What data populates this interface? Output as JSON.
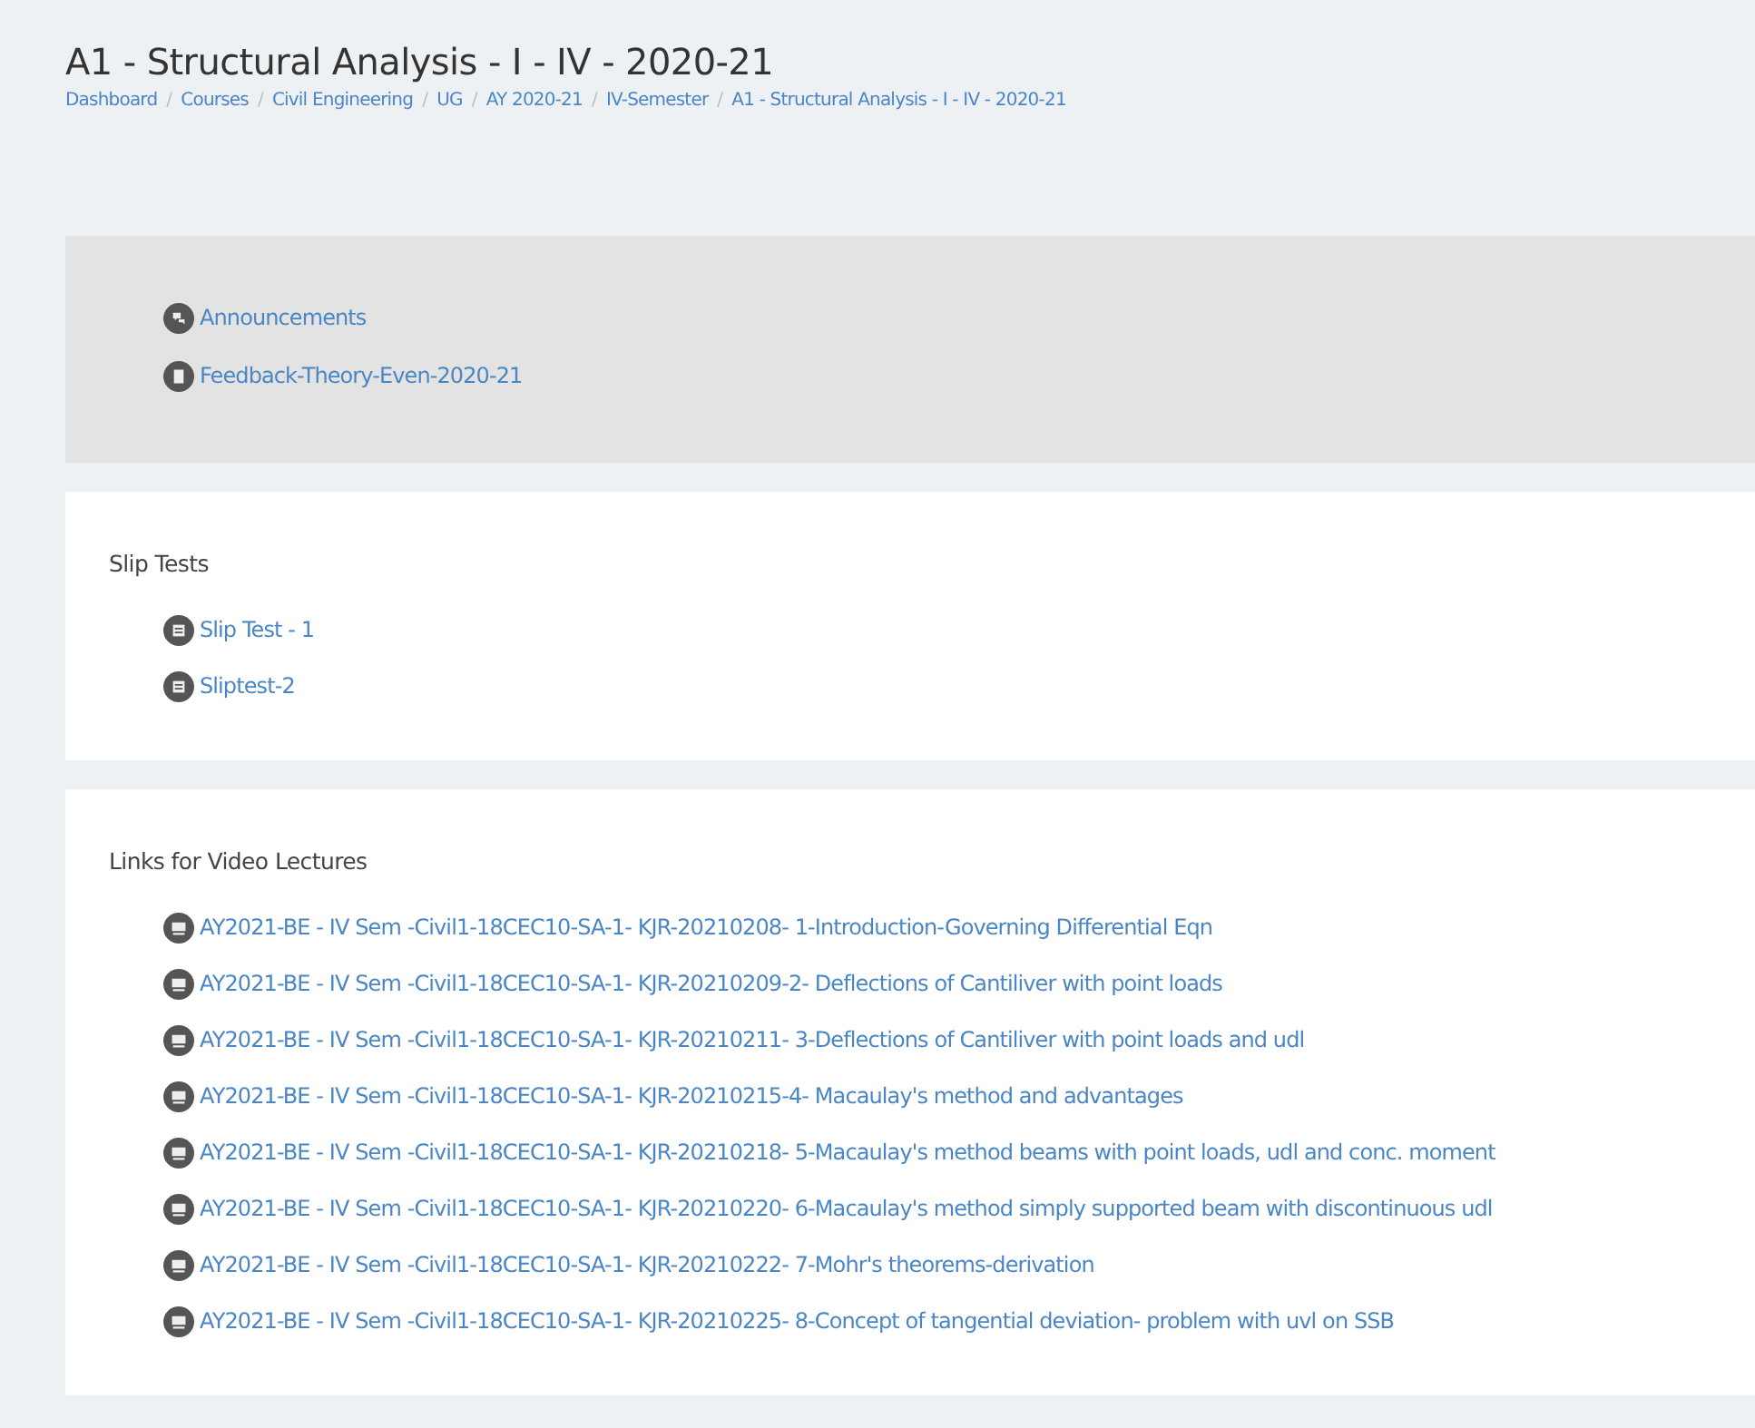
{
  "header": {
    "title": "A1 - Structural Analysis - I - IV - 2020-21",
    "breadcrumb_separator": "/",
    "breadcrumb": [
      "Dashboard",
      "Courses",
      "Civil Engineering",
      "UG",
      "AY 2020-21",
      "IV-Semester",
      "A1 - Structural Analysis - I - IV - 2020-21"
    ]
  },
  "sections": [
    {
      "kind": "highlight",
      "items": [
        {
          "kind": "forum",
          "label": "Announcements"
        },
        {
          "kind": "feedback",
          "label": "Feedback-Theory-Even-2020-21"
        }
      ]
    },
    {
      "kind": "plain",
      "title": "Slip Tests",
      "items": [
        {
          "kind": "quiz",
          "label": "Slip Test - 1"
        },
        {
          "kind": "quiz",
          "label": "Sliptest-2"
        }
      ]
    },
    {
      "kind": "plain",
      "title": "Links for Video Lectures",
      "items": [
        {
          "kind": "url",
          "label": "AY2021-BE - IV Sem -Civil1-18CEC10-SA-1- KJR-20210208- 1-Introduction-Governing Differential Eqn"
        },
        {
          "kind": "url",
          "label": "AY2021-BE - IV Sem -Civil1-18CEC10-SA-1- KJR-20210209-2- Deflections of Cantiliver with point loads"
        },
        {
          "kind": "url",
          "label": "AY2021-BE - IV Sem -Civil1-18CEC10-SA-1- KJR-20210211- 3-Deflections of Cantiliver with point loads and udl"
        },
        {
          "kind": "url",
          "label": "AY2021-BE - IV Sem -Civil1-18CEC10-SA-1- KJR-20210215-4- Macaulay's method and advantages"
        },
        {
          "kind": "url",
          "label": "AY2021-BE - IV Sem -Civil1-18CEC10-SA-1- KJR-20210218- 5-Macaulay's method beams with point loads, udl and conc. moment"
        },
        {
          "kind": "url",
          "label": "AY2021-BE - IV Sem -Civil1-18CEC10-SA-1- KJR-20210220- 6-Macaulay's method simply supported beam with discontinuous udl"
        },
        {
          "kind": "url",
          "label": "AY2021-BE - IV Sem -Civil1-18CEC10-SA-1- KJR-20210222- 7-Mohr's theorems-derivation"
        },
        {
          "kind": "url",
          "label": "AY2021-BE - IV Sem -Civil1-18CEC10-SA-1- KJR-20210225- 8-Concept of tangential deviation- problem with uvl on SSB"
        }
      ]
    }
  ]
}
